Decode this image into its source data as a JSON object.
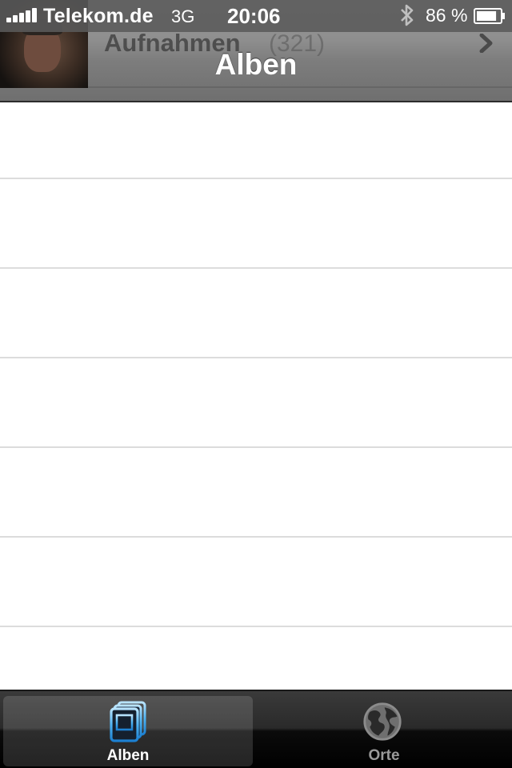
{
  "status_bar": {
    "carrier": "Telekom.de",
    "network": "3G",
    "time": "20:06",
    "battery_percent": "86 %",
    "battery_level": 0.86,
    "signal_bars": 5,
    "icons": [
      "signal-icon",
      "bluetooth-icon",
      "battery-icon"
    ]
  },
  "nav": {
    "title": "Alben",
    "album_row": {
      "name": "Aufnahmen",
      "count": "(321)"
    }
  },
  "list": {
    "rows": [
      "",
      "",
      "",
      "",
      "",
      "",
      ""
    ]
  },
  "tabbar": {
    "tabs": [
      {
        "label": "Alben",
        "icon": "albums-icon",
        "active": true
      },
      {
        "label": "Orte",
        "icon": "globe-icon",
        "active": false
      }
    ]
  },
  "colors": {
    "nav_bar": "#8e8e8e",
    "tab_bar": "#1a1a1a",
    "active_icon": "#3fa9f5",
    "separator": "#dcdcdc"
  }
}
